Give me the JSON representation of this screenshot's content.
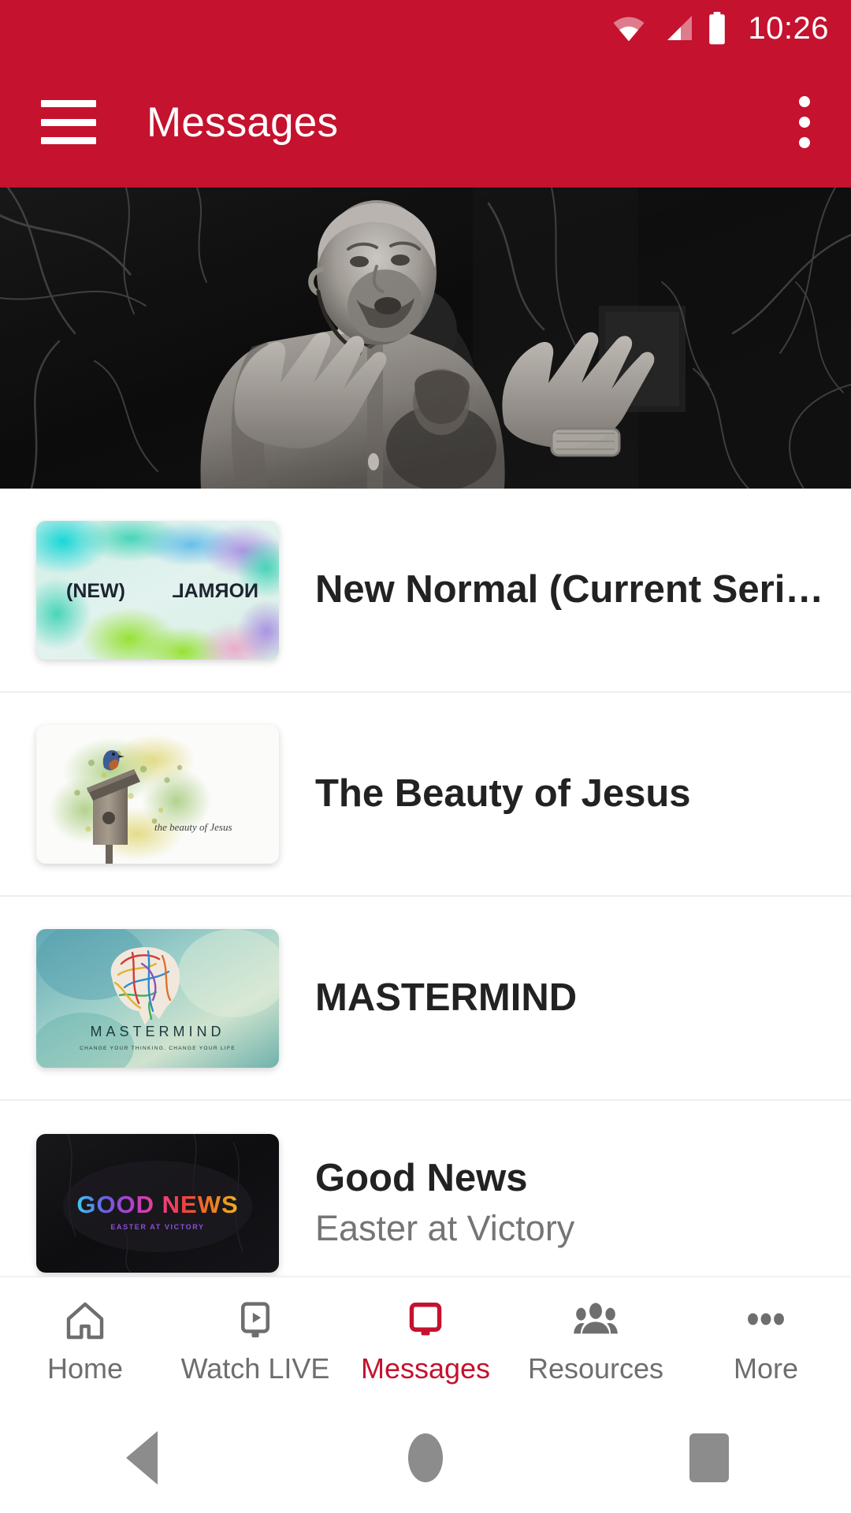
{
  "status_bar": {
    "time": "10:26",
    "wifi_icon": "wifi-icon",
    "signal_icon": "cellular-signal-icon",
    "battery_icon": "battery-full-icon"
  },
  "app_bar": {
    "menu_icon": "hamburger-menu-icon",
    "title": "Messages",
    "overflow_icon": "overflow-menu-icon"
  },
  "hero": {
    "alt": "Black and white photo of a speaker with headset microphone gesturing on stage with tree branches in background"
  },
  "colors": {
    "brand_red": "#C4122F",
    "title_text": "#222222",
    "subtitle_text": "#757575",
    "nav_inactive": "#6E6E6E",
    "divider": "#EEEEEE"
  },
  "list": {
    "items": [
      {
        "title": "New Normal (Current Seri…",
        "subtitle": "",
        "thumb_name": "thumbnail-new-normal",
        "thumb_text_left": "(NEW)",
        "thumb_text_right": "NORMAL"
      },
      {
        "title": "The Beauty of Jesus",
        "subtitle": "",
        "thumb_name": "thumbnail-the-beauty-of-jesus",
        "thumb_text_script": "the beauty of Jesus"
      },
      {
        "title": "MASTERMIND",
        "subtitle": "",
        "thumb_name": "thumbnail-mastermind",
        "thumb_text_main": "MASTERMIND",
        "thumb_text_tag": "CHANGE YOUR THINKING. CHANGE YOUR LIFE"
      },
      {
        "title": "Good News",
        "subtitle": "Easter at Victory",
        "thumb_name": "thumbnail-good-news",
        "thumb_text_main": "GOOD NEWS",
        "thumb_text_tag": "EASTER AT VICTORY"
      }
    ]
  },
  "bottom_nav": {
    "items": [
      {
        "label": "Home",
        "icon": "home-icon",
        "active": false
      },
      {
        "label": "Watch LIVE",
        "icon": "video-play-icon",
        "active": false
      },
      {
        "label": "Messages",
        "icon": "monitor-icon",
        "active": true
      },
      {
        "label": "Resources",
        "icon": "people-group-icon",
        "active": false
      },
      {
        "label": "More",
        "icon": "more-dots-icon",
        "active": false
      }
    ]
  },
  "system_nav": {
    "back": "back-triangle-icon",
    "home": "home-circle-icon",
    "recents": "recents-square-icon"
  }
}
